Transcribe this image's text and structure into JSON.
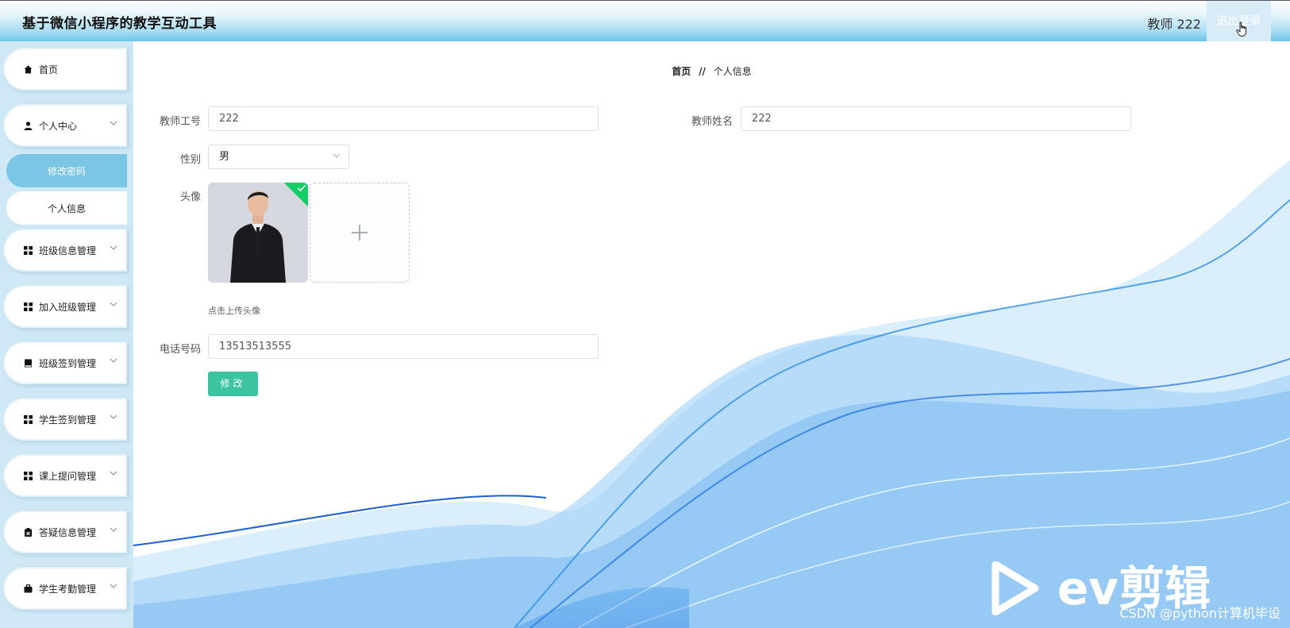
{
  "header": {
    "app_title": "基于微信小程序的教学互动工具",
    "user_label": "教师 222",
    "logout_label": "退出登录"
  },
  "sidebar": {
    "items": [
      {
        "label": "首页",
        "icon": "home-icon"
      },
      {
        "label": "个人中心",
        "icon": "user-icon"
      },
      {
        "label": "班级信息管理",
        "icon": "grid-icon"
      },
      {
        "label": "加入班级管理",
        "icon": "grid-icon"
      },
      {
        "label": "班级签到管理",
        "icon": "book-icon"
      },
      {
        "label": "学生签到管理",
        "icon": "grid-icon"
      },
      {
        "label": "课上提问管理",
        "icon": "grid-icon"
      },
      {
        "label": "答疑信息管理",
        "icon": "clipboard-icon"
      },
      {
        "label": "学生考勤管理",
        "icon": "briefcase-icon"
      }
    ],
    "sub_items": [
      {
        "label": "修改密码",
        "active": true
      },
      {
        "label": "个人信息",
        "active": false
      }
    ]
  },
  "breadcrumb": {
    "home": "首页",
    "separator": "//",
    "current": "个人信息"
  },
  "form": {
    "teacher_id_label": "教师工号",
    "teacher_id_value": "222",
    "teacher_name_label": "教师姓名",
    "teacher_name_value": "222",
    "gender_label": "性别",
    "gender_value": "男",
    "avatar_label": "头像",
    "upload_hint": "点击上传头像",
    "phone_label": "电话号码",
    "phone_value": "13513513555",
    "submit_label": "修改"
  },
  "watermark": {
    "brand": "ev剪辑",
    "credit": "CSDN @python计算机毕设"
  },
  "colors": {
    "accent": "#7ac6e4",
    "submit": "#3cc4a0",
    "header_gradient_end": "#6cc4ea",
    "wave": "#2f8fe6"
  }
}
